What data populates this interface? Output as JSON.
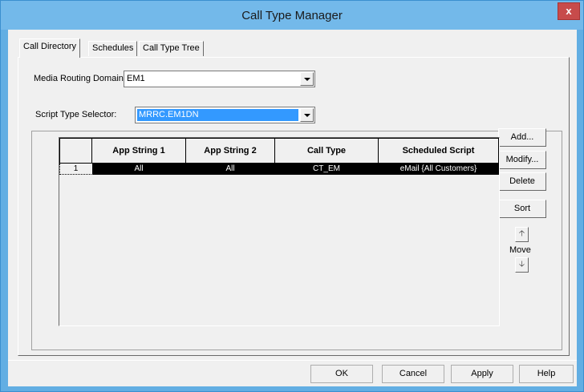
{
  "window": {
    "title": "Call Type Manager",
    "close_label": "x"
  },
  "tabs": [
    {
      "label": "Call Directory",
      "active": true
    },
    {
      "label": "Schedules",
      "active": false
    },
    {
      "label": "Call Type Tree",
      "active": false
    }
  ],
  "media_routing_domain": {
    "label": "Media Routing Domain:",
    "value": "EM1"
  },
  "script_type_selector": {
    "label": "Script Type Selector:",
    "value": "MRRC.EM1DN"
  },
  "grid": {
    "columns": [
      "",
      "App String 1",
      "App String 2",
      "Call Type",
      "Scheduled Script"
    ],
    "rows": [
      {
        "num": "1",
        "app_string_1": "All",
        "app_string_2": "All",
        "call_type": "CT_EM",
        "scheduled_script": "eMail {All Customers}"
      }
    ]
  },
  "side_buttons": {
    "add": "Add...",
    "modify": "Modify...",
    "delete": "Delete",
    "sort": "Sort",
    "move": "Move"
  },
  "footer": {
    "ok": "OK",
    "cancel": "Cancel",
    "apply": "Apply",
    "help": "Help"
  },
  "colors": {
    "title_bar": "#73b9ea",
    "selection": "#3399ff",
    "close": "#c74b4b"
  }
}
